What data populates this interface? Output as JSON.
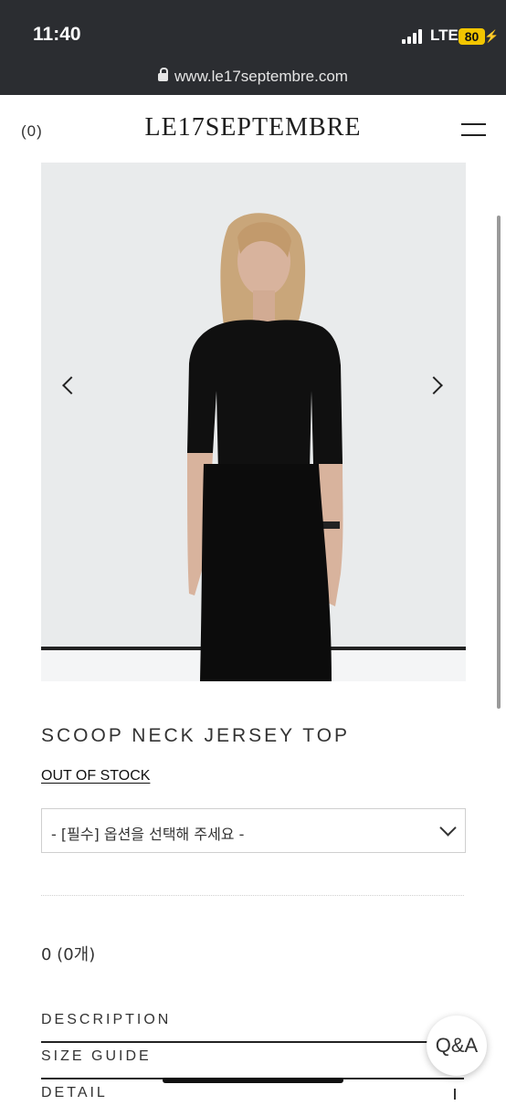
{
  "status_bar": {
    "time": "11:40",
    "network": "LTE",
    "battery": "80"
  },
  "browser": {
    "url": "www.le17septembre.com"
  },
  "header": {
    "cart_count": "(0)",
    "brand": "LE17SEPTEMBRE"
  },
  "product": {
    "title": "SCOOP NECK JERSEY TOP",
    "stock_status": "OUT OF STOCK",
    "option_placeholder": "- [필수] 옵션을 선택해 주세요 -",
    "quantity_total": "0 (0개)"
  },
  "accordion": [
    {
      "label": "DESCRIPTION"
    },
    {
      "label": "SIZE GUIDE"
    },
    {
      "label": "DETAIL"
    }
  ],
  "floating": {
    "qa_label": "Q&A"
  },
  "icons": [
    "lock-icon",
    "menu-icon",
    "chevron-left-icon",
    "chevron-right-icon",
    "chevron-down-icon",
    "plus-icon"
  ],
  "colors": {
    "status_bar_bg": "#2b2d31",
    "battery": "#f2c500",
    "image_bg": "#e9ebec"
  }
}
